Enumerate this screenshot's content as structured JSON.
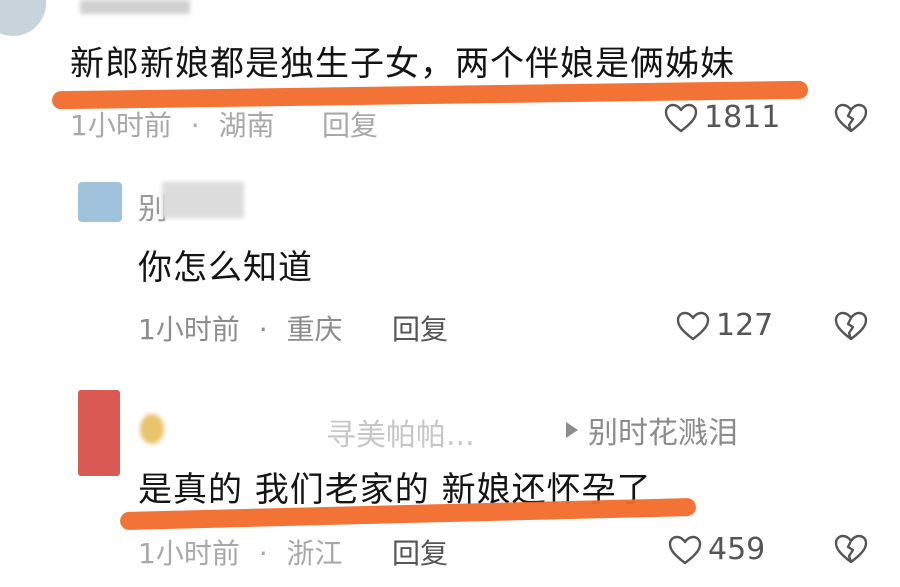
{
  "comments": [
    {
      "text": "新郎新娘都是独生子女，两个伴娘是俩姊妹",
      "time": "1小时前",
      "location": "湖南",
      "reply_label": "回复",
      "likes": "1811",
      "colors": {
        "underline": "#f26a2a",
        "avatar": "#c9d3dc"
      }
    },
    {
      "author": "别",
      "text": "你怎么知道",
      "time": "1小时前",
      "location": "重庆",
      "reply_label": "回复",
      "likes": "127",
      "colors": {
        "avatar": "#9fc3dd"
      }
    },
    {
      "author_partial": "寻美帕帕...",
      "reply_to": "别时花溅泪",
      "text": "是真的 我们老家的 新娘还怀孕了",
      "time": "1小时前",
      "location": "浙江",
      "reply_label": "回复",
      "likes": "459",
      "colors": {
        "underline": "#f26a2a",
        "avatar": "#d85a52"
      }
    }
  ],
  "icons": {
    "like": "heart-icon",
    "dislike": "broken-heart-icon",
    "reply_arrow": "play-triangle-icon"
  }
}
